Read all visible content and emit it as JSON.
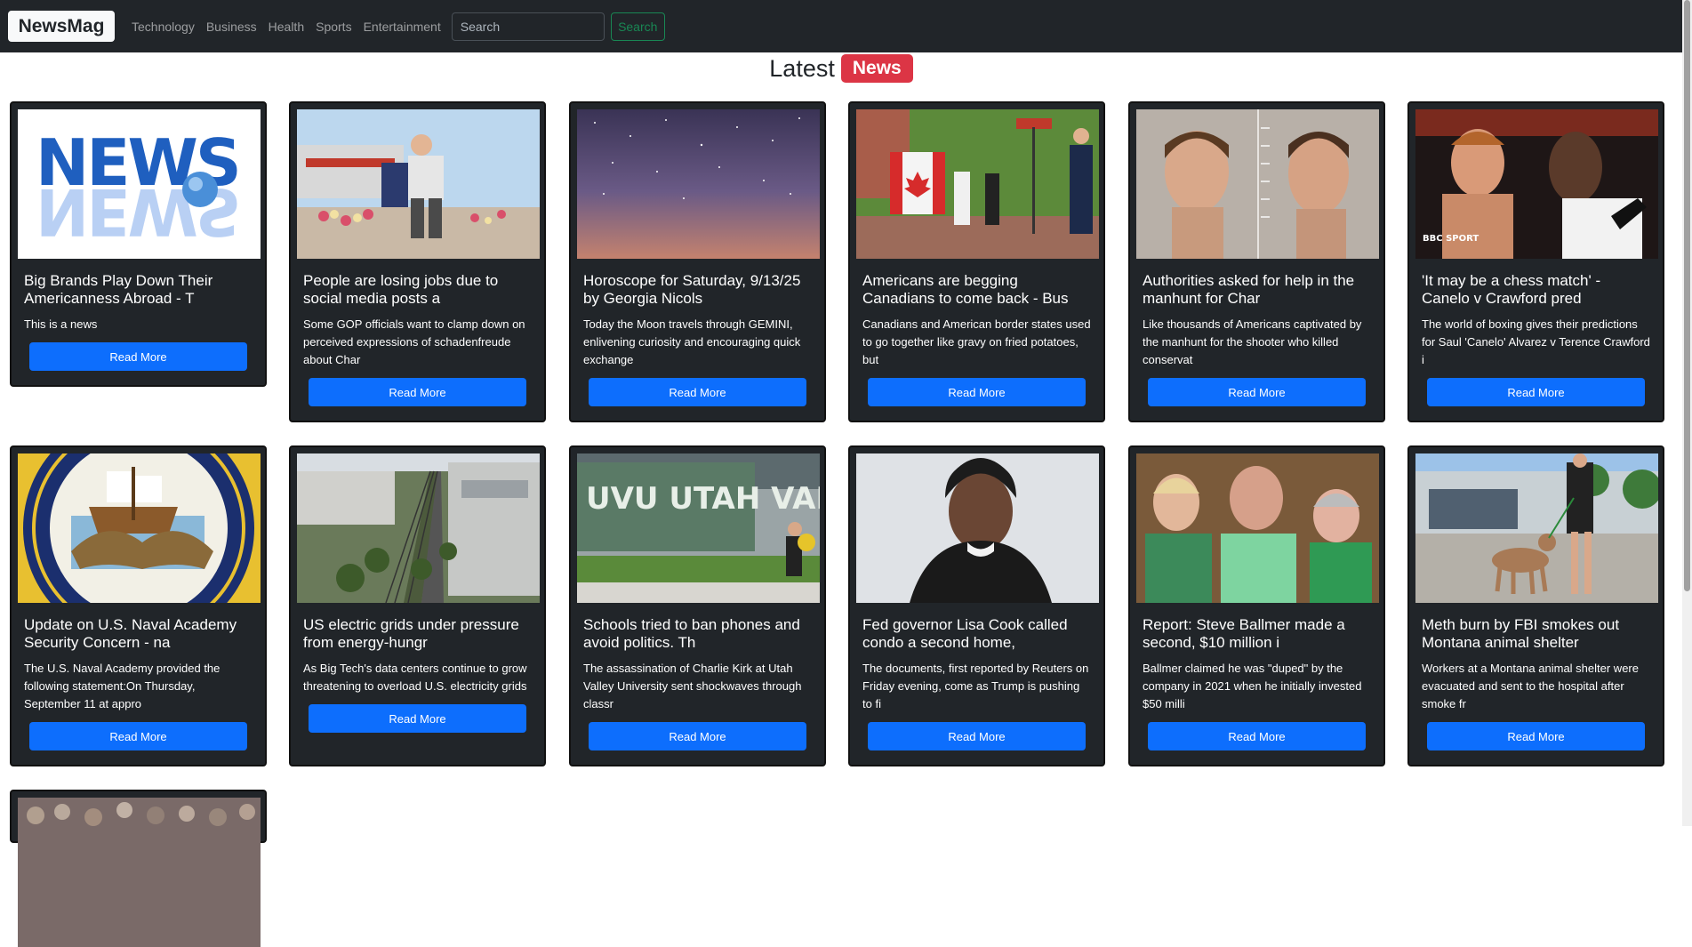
{
  "navbar": {
    "brand": "NewsMag",
    "links": [
      "Technology",
      "Business",
      "Health",
      "Sports",
      "Entertainment"
    ],
    "search_placeholder": "Search",
    "search_button": "Search"
  },
  "heading": {
    "text": "Latest",
    "badge": "News"
  },
  "cards": [
    {
      "title": "Big Brands Play Down Their Americanness Abroad - T",
      "text": "This is a news",
      "button": "Read More",
      "image": "news-logo"
    },
    {
      "title": "People are losing jobs due to social media posts a",
      "text": "Some GOP officials want to clamp down on perceived expressions of schadenfreude about Char",
      "button": "Read More",
      "image": "memorial-photo"
    },
    {
      "title": "Horoscope for Saturday, 9/13/25 by Georgia Nicols",
      "text": "Today the Moon travels through GEMINI, enlivening curiosity and encouraging quick exchange",
      "button": "Read More",
      "image": "night-sky"
    },
    {
      "title": "Americans are begging Canadians to come back - Bus",
      "text": "Canadians and American border states used to go together like gravy on fried potatoes, but",
      "button": "Read More",
      "image": "canada-street-sign"
    },
    {
      "title": "Authorities asked for help in the manhunt for Char",
      "text": "Like thousands of Americans captivated by the manhunt for the shooter who killed conservat",
      "button": "Read More",
      "image": "mugshot"
    },
    {
      "title": "'It may be a chess match' - Canelo v Crawford pred",
      "text": "The world of boxing gives their predictions for Saul 'Canelo' Alvarez v Terence Crawford i",
      "button": "Read More",
      "image": "boxers",
      "image_caption": "BBC SPORT"
    },
    {
      "title": "Update on U.S. Naval Academy Security Concern - na",
      "text": "The U.S. Naval Academy provided the following statement:On Thursday, September 11 at appro",
      "button": "Read More",
      "image": "navy-seal"
    },
    {
      "title": "US electric grids under pressure from energy-hungr",
      "text": "As Big Tech's data centers continue to grow threatening to overload U.S. electricity grids",
      "button": "Read More",
      "image": "power-lines"
    },
    {
      "title": "Schools tried to ban phones and avoid politics. Th",
      "text": "The assassination of Charlie Kirk at Utah Valley University sent shockwaves through classr",
      "button": "Read More",
      "image": "uvu-sign",
      "image_caption": "UVU UTAH VALLEY UNIVERSITY"
    },
    {
      "title": "Fed governor Lisa Cook called condo a second home,",
      "text": "The documents, first reported by Reuters on Friday evening, come as Trump is pushing to fi",
      "button": "Read More",
      "image": "portrait"
    },
    {
      "title": "Report: Steve Ballmer made a second, $10 million i",
      "text": "Ballmer claimed he was \"duped\" by the company in 2021 when he initially invested $50 milli",
      "button": "Read More",
      "image": "spectators"
    },
    {
      "title": "Meth burn by FBI smokes out Montana animal shelter",
      "text": "Workers at a Montana animal shelter were evacuated and sent to the hospital after smoke fr",
      "button": "Read More",
      "image": "dog-walk"
    }
  ]
}
